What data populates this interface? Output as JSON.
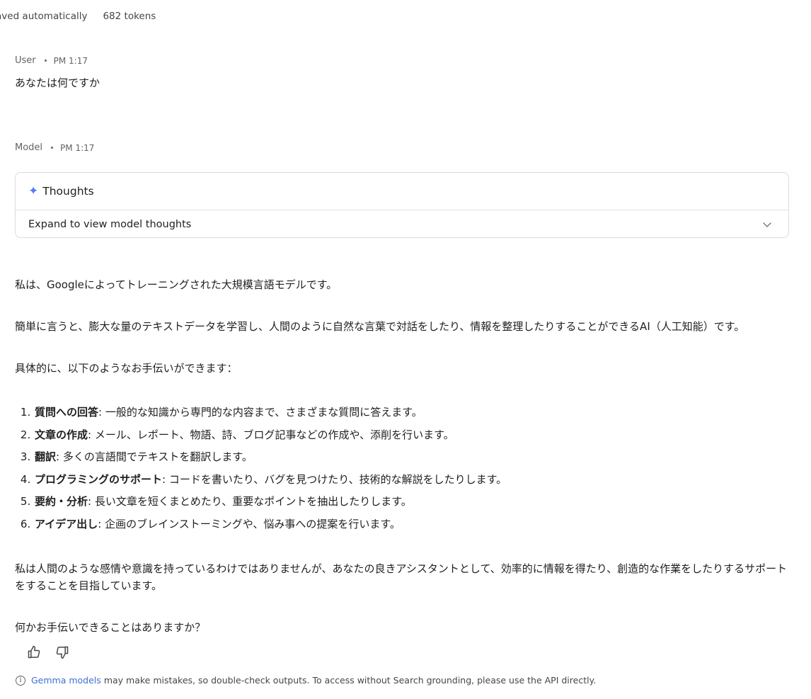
{
  "topbar": {
    "save_status": "aved automatically",
    "tokens": "682 tokens"
  },
  "user_turn": {
    "role": "User",
    "time": "PM 1:17",
    "text": "あなたは何ですか"
  },
  "model_turn": {
    "role": "Model",
    "time": "PM 1:17",
    "thoughts": {
      "title": "Thoughts",
      "expand_label": "Expand to view model thoughts"
    },
    "paragraphs": [
      "私は、Googleによってトレーニングされた大規模言語モデルです。",
      "簡単に言うと、膨大な量のテキストデータを学習し、人間のように自然な言葉で対話をしたり、情報を整理したりすることができるAI（人工知能）です。",
      "具体的に、以下のようなお手伝いができます："
    ],
    "list": [
      {
        "num": "1.",
        "bold": "質問への回答",
        "text": ": 一般的な知識から専門的な内容まで、さまざまな質問に答えます。"
      },
      {
        "num": "2.",
        "bold": "文章の作成",
        "text": ": メール、レポート、物語、詩、ブログ記事などの作成や、添削を行います。"
      },
      {
        "num": "3.",
        "bold": "翻訳",
        "text": ": 多くの言語間でテキストを翻訳します。"
      },
      {
        "num": "4.",
        "bold": "プログラミングのサポート",
        "text": ": コードを書いたり、バグを見つけたり、技術的な解説をしたりします。"
      },
      {
        "num": "5.",
        "bold": "要約・分析",
        "text": ": 長い文章を短くまとめたり、重要なポイントを抽出したりします。"
      },
      {
        "num": "6.",
        "bold": "アイデア出し",
        "text": ": 企画のブレインストーミングや、悩み事への提案を行います。"
      }
    ],
    "closing": [
      "私は人間のような感情や意識を持っているわけではありませんが、あなたの良きアシスタントとして、効率的に情報を得たり、創造的な作業をしたりするサポートをすることを目指しています。",
      "何かお手伝いできることはありますか？"
    ]
  },
  "feedback": {
    "like_icon": "thumbs-up-icon",
    "dislike_icon": "thumbs-down-icon"
  },
  "disclaimer": {
    "icon": "info-icon",
    "link_text": "Gemma models",
    "text": "may make mistakes, so double-check outputs. To access without Search grounding, please use the API directly."
  },
  "colors": {
    "accent": "#4f7ef0",
    "link": "#3f6fd8",
    "border": "#dadce0"
  }
}
